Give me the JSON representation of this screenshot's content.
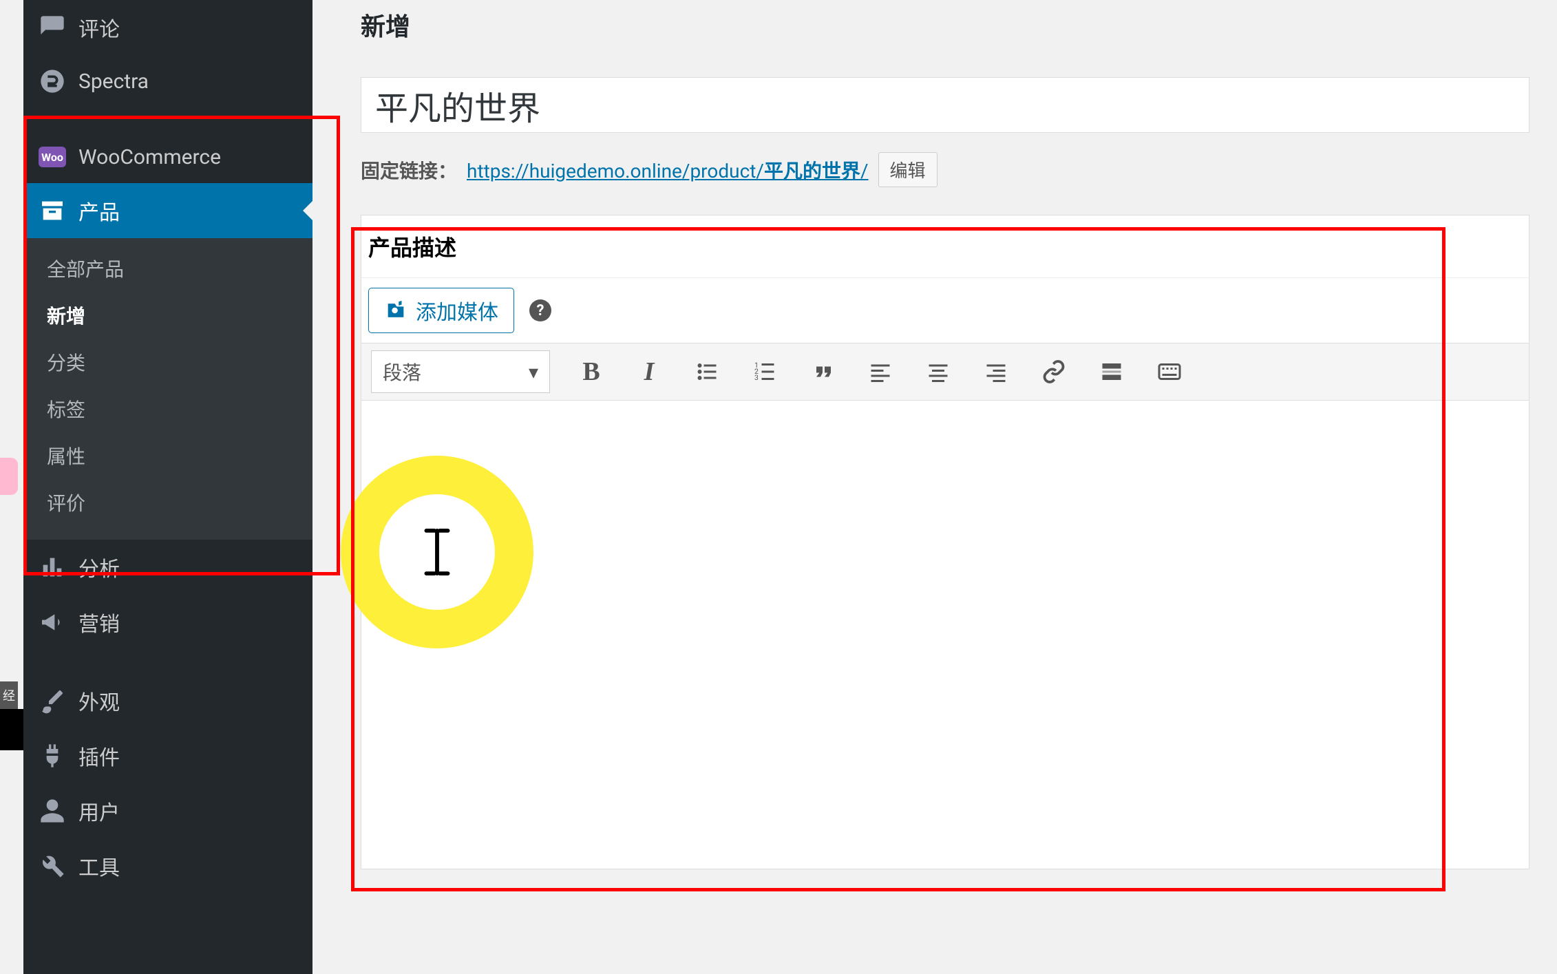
{
  "page": {
    "heading": "新增",
    "title_value": "平凡的世界"
  },
  "permalink": {
    "label": "固定链接：",
    "base": "https://huigedemo.online/product/",
    "slug": "平凡的世界",
    "trail": "/",
    "edit_label": "编辑"
  },
  "editor": {
    "section_title": "产品描述",
    "add_media_label": "添加媒体",
    "format_selected": "段落"
  },
  "sidebar": {
    "comments_label": "评论",
    "spectra_label": "Spectra",
    "woocommerce_label": "WooCommerce",
    "products_label": "产品",
    "analytics_label": "分析",
    "marketing_label": "营销",
    "appearance_label": "外观",
    "plugins_label": "插件",
    "users_label": "用户",
    "tools_label": "工具",
    "sub": {
      "all": "全部产品",
      "add": "新增",
      "categories": "分类",
      "tags": "标签",
      "attributes": "属性",
      "reviews": "评价"
    }
  },
  "woo_badge": "Woo"
}
